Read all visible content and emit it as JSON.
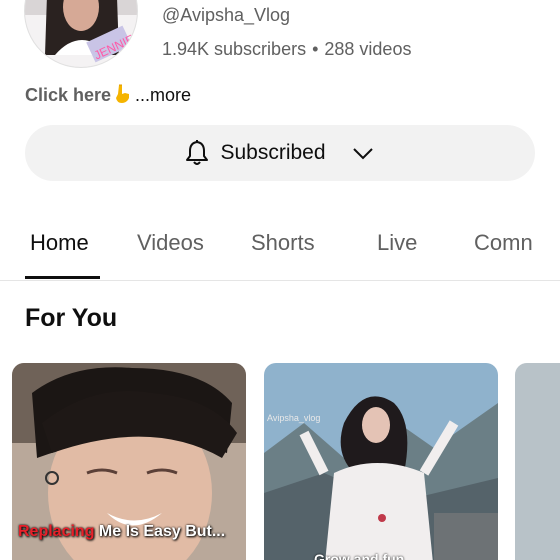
{
  "channel": {
    "handle": "@Avipsha_Vlog",
    "subscribers": "1.94K subscribers",
    "separator": "•",
    "videos": "288 videos",
    "description_prefix": "Click here",
    "description_emoji": "pointing-down-hand-icon",
    "more_label": "...more"
  },
  "subscribe": {
    "label": "Subscribed",
    "bell_icon": "bell-icon",
    "chevron_icon": "chevron-down-icon"
  },
  "tabs": [
    {
      "label": "Home",
      "active": true
    },
    {
      "label": "Videos",
      "active": false
    },
    {
      "label": "Shorts",
      "active": false
    },
    {
      "label": "Live",
      "active": false
    },
    {
      "label": "Comn",
      "active": false
    }
  ],
  "section": {
    "title": "For You"
  },
  "videos": [
    {
      "overlay_red": "Replacing",
      "overlay_white": " Me Is Easy But..."
    },
    {
      "watermark": "Avipsha_vlog",
      "overlay_bottom": "Grow and fun"
    },
    {}
  ]
}
